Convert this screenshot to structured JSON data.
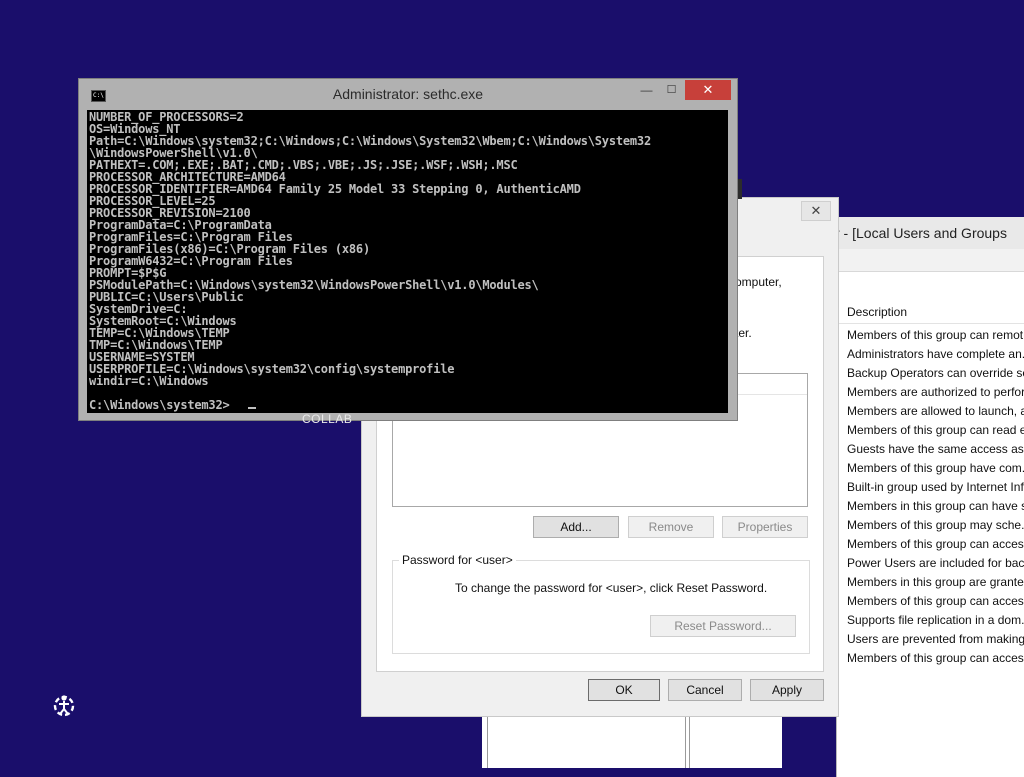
{
  "mmc": {
    "title": "r - [Local Users and Groups",
    "column_header": "Description",
    "descriptions": [
      "Members of this group can remot",
      "Administrators have complete an..",
      "Backup Operators can override se..",
      "Members are authorized to perfor",
      "Members are allowed to launch, a",
      "Members of this group can read e",
      "Guests have the same access as m",
      "Members of this group have com..",
      "Built-in group used by Internet Inf",
      "Members in this group can have s",
      "Members of this group may sche..",
      "Members of this group can acces..",
      "Power Users are included for back",
      "Members in this group are grante..",
      "Members of this group can acces..",
      "Supports file replication in a dom..",
      "Users are prevented from making",
      "Members of this group can acces.."
    ]
  },
  "dialog": {
    "close_symbol": "✕",
    "fragment_computer": "omputer,",
    "fragment_ter": "ter.",
    "add_label": "Add...",
    "remove_label": "Remove",
    "properties_label": "Properties",
    "password_group_label": "Password for <user>",
    "password_text": "To change the password for <user>, click Reset Password.",
    "reset_label": "Reset Password...",
    "ok_label": "OK",
    "cancel_label": "Cancel",
    "apply_label": "Apply"
  },
  "cmd": {
    "title": "Administrator: sethc.exe",
    "icon_text": "C:\\",
    "minimize_symbol": "—",
    "maximize_symbol": "☐",
    "close_symbol": "✕",
    "output": "NUMBER_OF_PROCESSORS=2\nOS=Windows_NT\nPath=C:\\Windows\\system32;C:\\Windows;C:\\Windows\\System32\\Wbem;C:\\Windows\\System32\n\\WindowsPowerShell\\v1.0\\\nPATHEXT=.COM;.EXE;.BAT;.CMD;.VBS;.VBE;.JS;.JSE;.WSF;.WSH;.MSC\nPROCESSOR_ARCHITECTURE=AMD64\nPROCESSOR_IDENTIFIER=AMD64 Family 25 Model 33 Stepping 0, AuthenticAMD\nPROCESSOR_LEVEL=25\nPROCESSOR_REVISION=2100\nProgramData=C:\\ProgramData\nProgramFiles=C:\\Program Files\nProgramFiles(x86)=C:\\Program Files (x86)\nProgramW6432=C:\\Program Files\nPROMPT=$P$G\nPSModulePath=C:\\Windows\\system32\\WindowsPowerShell\\v1.0\\Modules\\\nPUBLIC=C:\\Users\\Public\nSystemDrive=C:\nSystemRoot=C:\\Windows\nTEMP=C:\\Windows\\TEMP\nTMP=C:\\Windows\\TEMP\nUSERNAME=SYSTEM\nUSERPROFILE=C:\\Windows\\system32\\config\\systemprofile\nwindir=C:\\Windows\n\nC:\\Windows\\system32>"
  },
  "desktop": {
    "collab_text": "COLLAB",
    "ease_of_access_icon": "ease-of-access-icon"
  },
  "colors": {
    "background": "#1a0e6b",
    "close_button": "#c7403a",
    "console_bg": "#000000",
    "console_fg": "#c0c0c0"
  }
}
